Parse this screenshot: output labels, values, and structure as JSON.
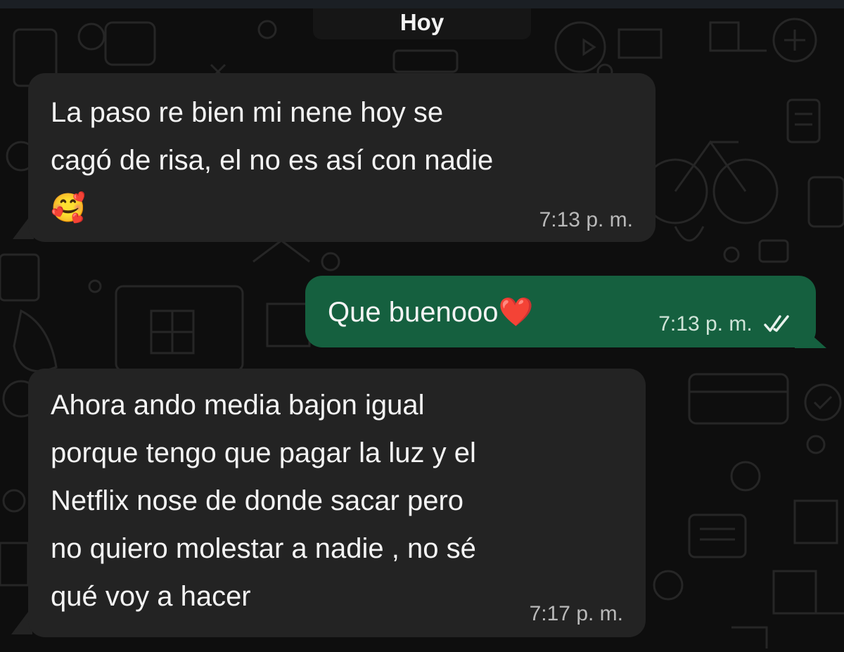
{
  "chat": {
    "date_label": "Hoy",
    "messages": [
      {
        "direction": "incoming",
        "text": "La paso re bien mi nene hoy se\ncagó de risa, el no es así con nadie",
        "emoji": "🥰",
        "time": "7:13 p. m."
      },
      {
        "direction": "outgoing",
        "text": "Que buenooo",
        "emoji": "❤️",
        "time": "7:13 p. m.",
        "status_icon": "double-check-icon"
      },
      {
        "direction": "incoming",
        "text": "Ahora ando media bajon igual\nporque tengo que pagar la luz y el\nNetflix nose de donde sacar pero\nno quiero molestar a nadie , no sé\nqué voy a hacer",
        "time": "7:17 p. m."
      }
    ]
  },
  "colors": {
    "background": "#0e0e0e",
    "incoming_bubble": "#232323",
    "outgoing_bubble": "#15603f",
    "text": "#f4f4f4",
    "timestamp": "#b9b9b9"
  }
}
